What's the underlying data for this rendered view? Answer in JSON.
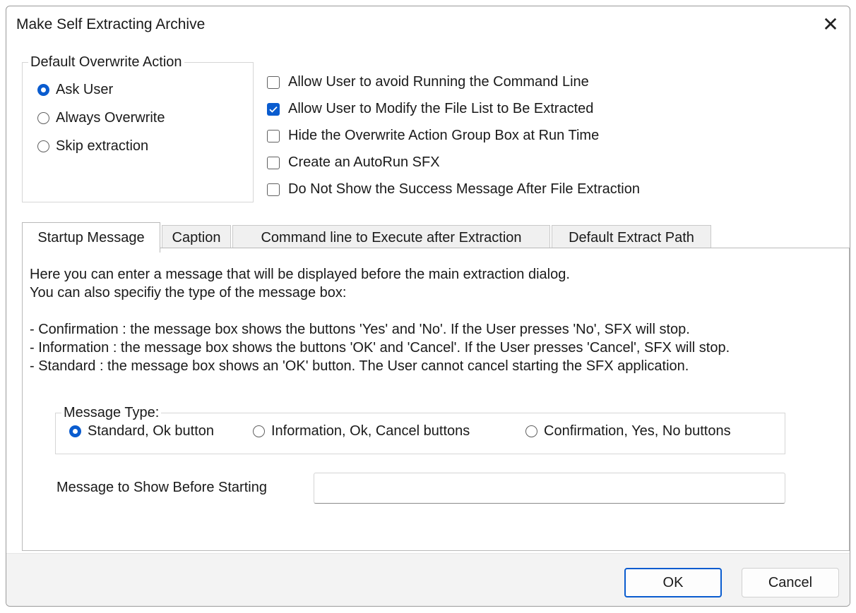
{
  "window": {
    "title": "Make Self Extracting Archive",
    "close_glyph": "✕"
  },
  "overwrite_group": {
    "legend": "Default Overwrite Action",
    "options": [
      {
        "label": "Ask User",
        "selected": true
      },
      {
        "label": "Always Overwrite",
        "selected": false
      },
      {
        "label": "Skip extraction",
        "selected": false
      }
    ]
  },
  "checkboxes": [
    {
      "label": "Allow User to avoid Running the Command Line",
      "checked": false
    },
    {
      "label": "Allow User to Modify the File List to Be Extracted",
      "checked": true
    },
    {
      "label": "Hide the Overwrite Action Group Box at Run Time",
      "checked": false
    },
    {
      "label": "Create an AutoRun SFX",
      "checked": false
    },
    {
      "label": "Do Not Show the Success Message After File Extraction",
      "checked": false
    }
  ],
  "tabs": [
    {
      "label": "Startup Message",
      "active": true
    },
    {
      "label": "Caption",
      "active": false
    },
    {
      "label": "Command line to Execute after Extraction",
      "active": false
    },
    {
      "label": "Default Extract Path",
      "active": false
    }
  ],
  "startup": {
    "description": [
      "Here you can enter a message that will be displayed before the main extraction dialog.",
      "You can also specifiy the type of the message box:",
      "",
      "- Confirmation : the message box shows the buttons 'Yes' and 'No'. If the User presses 'No', SFX will stop.",
      "- Information : the message box shows the buttons 'OK' and 'Cancel'. If the User presses 'Cancel', SFX will stop.",
      "- Standard : the message box shows an 'OK' button. The User cannot cancel starting the SFX application."
    ],
    "message_type": {
      "legend": "Message Type:",
      "options": [
        {
          "label": "Standard, Ok button",
          "selected": true
        },
        {
          "label": "Information, Ok, Cancel buttons",
          "selected": false
        },
        {
          "label": "Confirmation, Yes, No buttons",
          "selected": false
        }
      ]
    },
    "message_label": "Message to Show Before Starting",
    "message_value": ""
  },
  "buttons": {
    "ok": "OK",
    "cancel": "Cancel"
  },
  "colors": {
    "accent": "#0a5ccf",
    "footer": "#f3f3f3"
  }
}
